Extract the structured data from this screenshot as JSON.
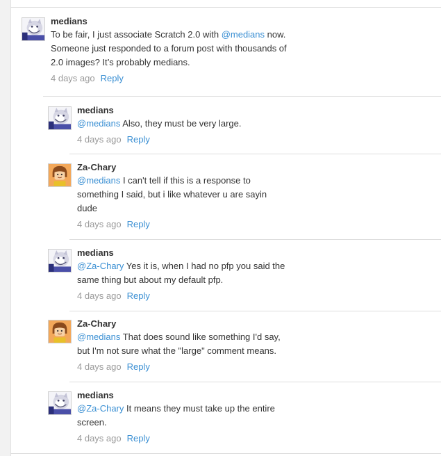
{
  "comments": [
    {
      "user": "medians",
      "avatar": "cat-avatar",
      "lines": [
        {
          "text": "To be fair, I just associate Scratch 2.0 with ",
          "mention": "@medians",
          "after": " now."
        },
        {
          "text": "Someone just responded to a forum post with thousands of"
        },
        {
          "text": "2.0 images? It’s probably medians."
        }
      ],
      "time": "4 days ago",
      "reply": "Reply"
    },
    {
      "user": "medians",
      "avatar": "cat-avatar",
      "lines": [
        {
          "mention": "@medians",
          "text": " Also, they must be very large."
        }
      ],
      "time": "4 days ago",
      "reply": "Reply"
    },
    {
      "user": "Za-Chary",
      "avatar": "boy-avatar",
      "lines": [
        {
          "mention": "@medians",
          "text": " I can't tell if this is a response to"
        },
        {
          "text": "something I said, but i like whatever u are sayin"
        },
        {
          "text": "dude"
        }
      ],
      "time": "4 days ago",
      "reply": "Reply"
    },
    {
      "user": "medians",
      "avatar": "cat-avatar",
      "lines": [
        {
          "mention": "@Za-Chary",
          "text": " Yes it is, when I had no pfp you said the"
        },
        {
          "text": "same thing but about my default pfp."
        }
      ],
      "time": "4 days ago",
      "reply": "Reply"
    },
    {
      "user": "Za-Chary",
      "avatar": "boy-avatar",
      "lines": [
        {
          "mention": "@medians",
          "text": " That does sound like something I'd say,"
        },
        {
          "text": "but I'm not sure what the \"large\" comment means."
        }
      ],
      "time": "4 days ago",
      "reply": "Reply"
    },
    {
      "user": "medians",
      "avatar": "cat-avatar",
      "lines": [
        {
          "mention": "@Za-Chary",
          "text": " It means they must take up the entire"
        },
        {
          "text": "screen."
        }
      ],
      "time": "4 days ago",
      "reply": "Reply"
    }
  ],
  "colors": {
    "mention": "#3a8fd3",
    "time": "#9a9a9a",
    "text": "#333333"
  }
}
